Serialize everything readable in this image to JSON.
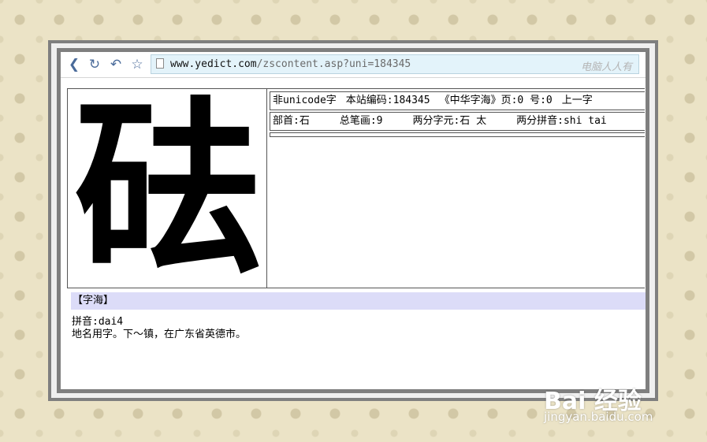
{
  "toolbar": {
    "back_icon": "chevron-left-icon",
    "refresh_icon": "refresh-icon",
    "undo_icon": "undo-icon",
    "favorite_icon": "star-icon"
  },
  "address_bar": {
    "url_domain": "www.yedict.com",
    "url_path": "/zscontent.asp?uni=184345",
    "overlay_logo": "电脑人人有"
  },
  "character": {
    "glyph": "砝"
  },
  "info": {
    "row1": {
      "unicode_status": "非unicode字",
      "site_code": "本站编码:184345",
      "zhonghua_ref": "《中华字海》页:0 号:0",
      "prev_char": "上一字"
    },
    "row2": {
      "radical": "部首:石",
      "strokes": "总笔画:9",
      "components": "两分字元:石 太",
      "pinyin_split": "两分拼音:shi tai"
    }
  },
  "definition": {
    "section_title": "【字海】",
    "pinyin": "拼音:dai4",
    "meaning": "地名用字。下～镇，在广东省英德市。"
  },
  "watermark": {
    "brand": "Bai 经验",
    "sub": "jingyan.baidu.com"
  }
}
